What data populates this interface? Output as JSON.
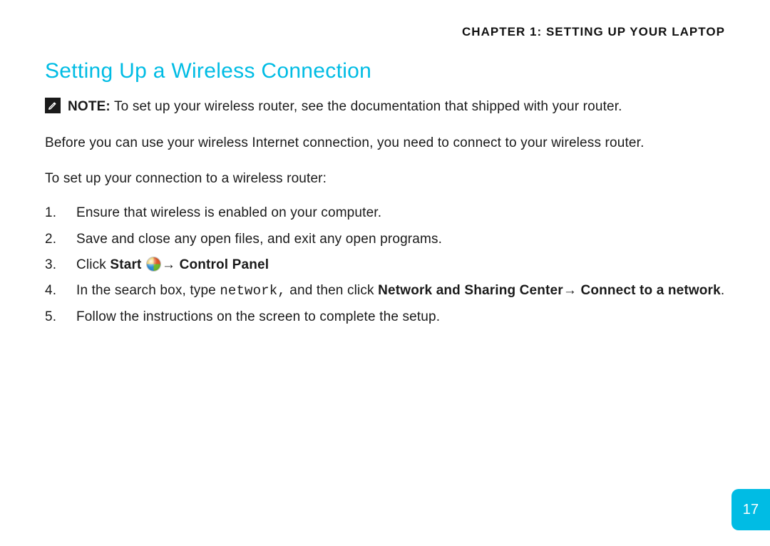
{
  "chapter_header": "CHAPTER 1:  SETTING UP YOUR LAPTOP",
  "section_title": "Setting Up a Wireless Connection",
  "note": {
    "label": "NOTE:",
    "text": " To set up your wireless router, see the documentation that shipped with your router."
  },
  "intro": "Before you can use your wireless Internet connection, you need to connect to your wireless router.",
  "lead_in": "To set up your connection to a wireless router:",
  "steps": {
    "s1": "Ensure that wireless is enabled on your computer.",
    "s2": "Save and close any open files, and exit any open programs.",
    "s3_pre": "Click ",
    "s3_start": "Start",
    "s3_arrow": "→ ",
    "s3_cp": "Control Panel",
    "s4_pre": "In the search box, type ",
    "s4_code": "network,",
    "s4_mid": " and then click ",
    "s4_nsc": "Network and Sharing Center",
    "s4_arrow": "→ ",
    "s4_ctn": "Connect to a network",
    "s4_end": ".",
    "s5": "Follow the instructions on the screen to complete the setup."
  },
  "page_number": "17"
}
